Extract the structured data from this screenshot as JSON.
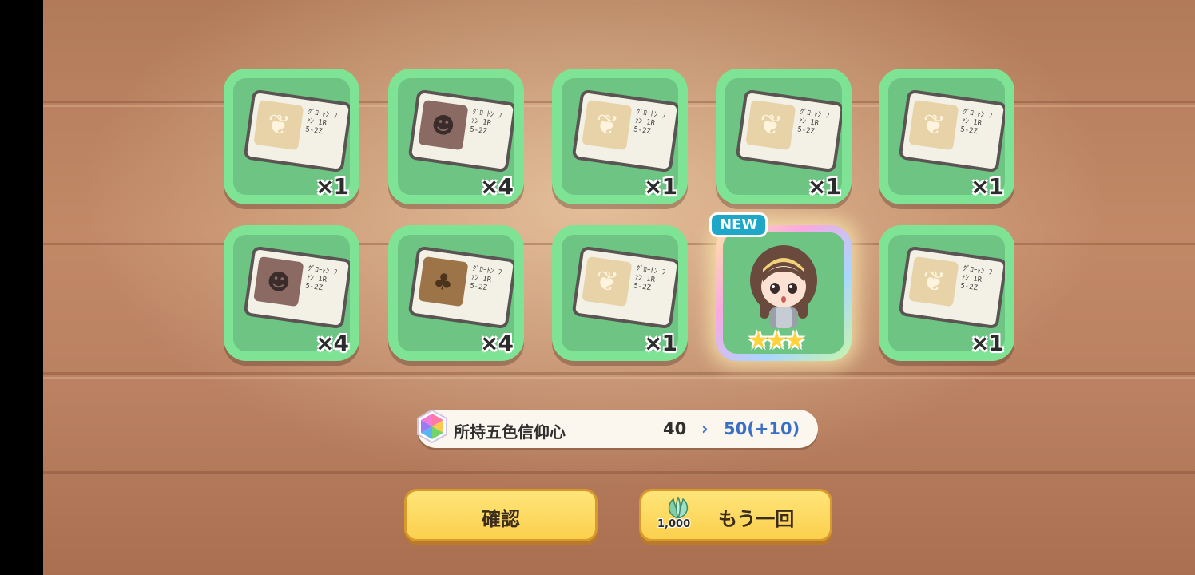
{
  "rewards": [
    {
      "kind": "sprout-card",
      "count": "×1"
    },
    {
      "kind": "hood-card",
      "count": "×4"
    },
    {
      "kind": "sprout-card",
      "count": "×1"
    },
    {
      "kind": "sprout-card",
      "count": "×1"
    },
    {
      "kind": "sprout-card",
      "count": "×1"
    },
    {
      "kind": "hood-card",
      "count": "×4"
    },
    {
      "kind": "tree-card",
      "count": "×4"
    },
    {
      "kind": "sprout-card",
      "count": "×1"
    },
    {
      "kind": "new-character",
      "badge": "NEW",
      "stars": 3
    },
    {
      "kind": "sprout-card",
      "count": "×1"
    }
  ],
  "card_text": "ｸﾞﾛｰﾄﾝ ﾌｧﾝ 1R 5-2Z",
  "faith": {
    "label": "所持五色信仰心",
    "old_value": "40",
    "arrow": "›",
    "new_value": "50(+10)"
  },
  "buttons": {
    "confirm": "確認",
    "again": "もう一回",
    "again_cost": "1,000"
  },
  "colors": {
    "slot_bg": "#7ee394",
    "button": "#fbd04d",
    "new_value": "#3a6fc6"
  }
}
